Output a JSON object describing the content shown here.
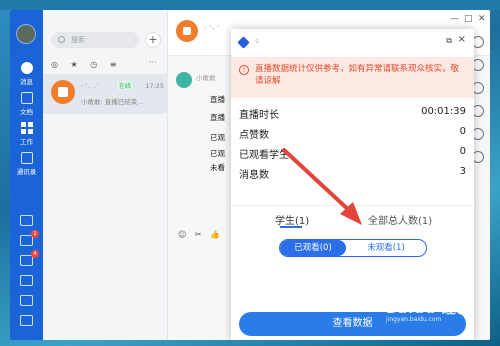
{
  "rail": {
    "items": [
      {
        "label": "消息"
      },
      {
        "label": "文档"
      },
      {
        "label": "工作"
      },
      {
        "label": "通讯录"
      }
    ],
    "badges": [
      "1",
      "4"
    ]
  },
  "list": {
    "search_placeholder": "搜索",
    "plus": "+",
    "filters": "◎ ★ ◷ ≡",
    "filters_more": "···",
    "conversation": {
      "name": "- '.. .'",
      "tag": "在线",
      "time": "17:25",
      "preview": "小敢敢: 直播已结束..."
    }
  },
  "chat": {
    "title": "- '- '",
    "sender": "小敢敢",
    "snippets": [
      "直播",
      "直播",
      "已观",
      "已观",
      "未看"
    ],
    "toolbar": "☺ ✂ 👍",
    "window_controls": [
      "—",
      "□",
      "✕"
    ]
  },
  "panel": {
    "subtitle": "♀",
    "notice": "直播数据统计仅供参考，如有异常请联系观众核实，敬请谅解",
    "stats": [
      {
        "label": "直播时长",
        "value": "00:01:39"
      },
      {
        "label": "点赞数",
        "value": "0"
      },
      {
        "label": "已观看学生",
        "value": "0"
      },
      {
        "label": "消息数",
        "value": "3"
      }
    ],
    "tabs": [
      {
        "label": "学生(1)"
      },
      {
        "label": "全部总人数(1)"
      }
    ],
    "toggle": {
      "on": "已观看(0)",
      "off": "未观看(1)"
    },
    "button": "查看数据"
  },
  "watermark": {
    "main": "Baidu 经验",
    "sub": "jingyan.baidu.com"
  },
  "colors": {
    "accent": "#2a6fe8",
    "rail": "#1a64d8",
    "warning": "#e04b2d",
    "arrow": "#e2453b"
  }
}
